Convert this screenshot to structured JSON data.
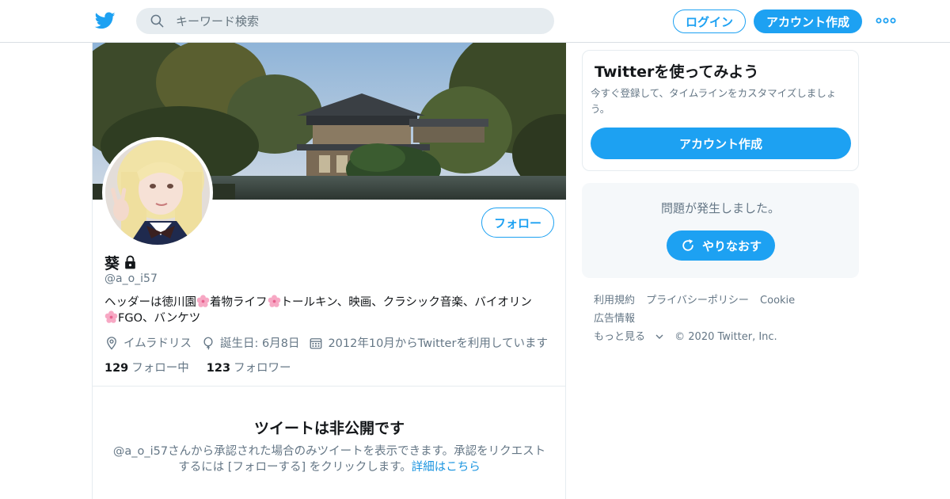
{
  "header": {
    "search_placeholder": "キーワード検索",
    "login_label": "ログイン",
    "signup_label": "アカウント作成"
  },
  "profile": {
    "name": "葵",
    "handle": "@a_o_i57",
    "bio": {
      "part1": "ヘッダーは徳川園",
      "part2": "着物ライフ",
      "part3": "トールキン、映画、クラシック音楽、バイオリン",
      "part4": "FGO、バンケツ"
    },
    "location": "イムラドリス",
    "birthday": "誕生日: 6月8日",
    "joined": "2012年10月からTwitterを利用しています",
    "following_count": "129",
    "following_label": "フォロー中",
    "followers_count": "123",
    "followers_label": "フォロワー",
    "follow_button": "フォロー",
    "protected_title": "ツイートは非公開です",
    "protected_text": "@a_o_i57さんから承認された場合のみツイートを表示できます。承認をリクエストするには [フォローする] をクリックします。",
    "protected_link": "詳細はこちら"
  },
  "sidebar": {
    "signup_title": "Twitterを使ってみよう",
    "signup_desc": "今すぐ登録して、タイムラインをカスタマイズしましょう。",
    "signup_button": "アカウント作成",
    "error_message": "問題が発生しました。",
    "retry_button": "やりなおす"
  },
  "footer": {
    "terms": "利用規約",
    "privacy": "プライバシーポリシー",
    "cookie": "Cookie",
    "ads": "広告情報",
    "more": "もっと見る",
    "copyright": "© 2020 Twitter, Inc."
  },
  "colors": {
    "brand": "#1da1f2",
    "secondary_text": "#657786",
    "link": "#1b95e0"
  },
  "icons": [
    "twitter-bird-icon",
    "search-icon",
    "more-dots-icon",
    "lock-icon",
    "location-icon",
    "balloon-icon",
    "calendar-icon",
    "refresh-icon",
    "chevron-down-icon",
    "cherry-blossom-icon"
  ]
}
